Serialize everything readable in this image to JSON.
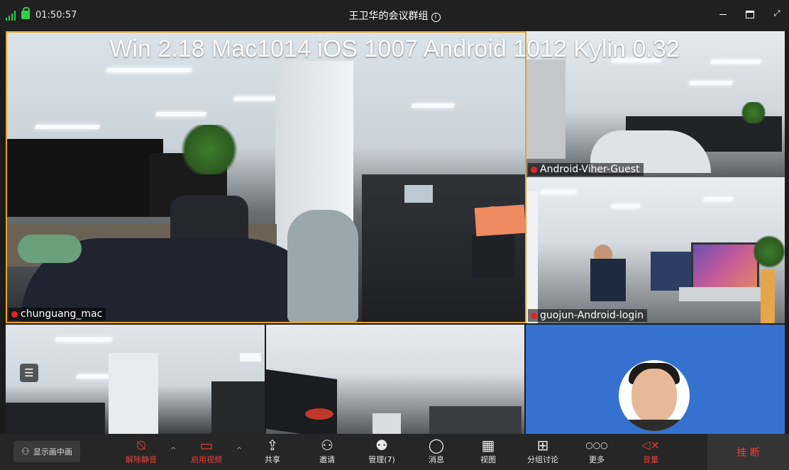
{
  "titlebar": {
    "time": "01:50:57",
    "title": "王卫华的会议群组",
    "info_glyph": "i",
    "minimize_icon": "minimize-icon",
    "maximize_icon": "maximize-icon",
    "exit_fullscreen_icon": "exit-fullscreen-icon"
  },
  "overlay": {
    "text": "Win 2.18 Mac1014 iOS 1007 Android 1012 Kylin 0.32"
  },
  "participants": [
    {
      "name": "chunguang_mac"
    },
    {
      "name": "Android-Viher-Guest"
    },
    {
      "name": "guojun-Android-login"
    }
  ],
  "list_button": {
    "glyph": "☰"
  },
  "toolbar": {
    "gallery_label": "显示画中画",
    "items": [
      {
        "label": "解除静音",
        "icon": "mic-muted-icon",
        "glyph": "⍉"
      },
      {
        "label": "启用视频",
        "icon": "video-off-icon",
        "glyph": "▭"
      },
      {
        "label": "共享",
        "icon": "share-icon",
        "glyph": "⇪"
      },
      {
        "label": "邀请",
        "icon": "invite-icon",
        "glyph": "⚇"
      },
      {
        "label": "管理(7)",
        "icon": "manage-participants-icon",
        "glyph": "⚉"
      },
      {
        "label": "消息",
        "icon": "message-icon",
        "glyph": "◯"
      },
      {
        "label": "视图",
        "icon": "view-icon",
        "glyph": "▦"
      },
      {
        "label": "分组讨论",
        "icon": "breakout-icon",
        "glyph": "⊞"
      },
      {
        "label": "更多",
        "icon": "more-icon",
        "glyph": "○○○"
      },
      {
        "label": "音量",
        "icon": "speaker-muted-icon",
        "glyph": "◁×"
      }
    ],
    "chevron": "^",
    "hangup_label": "挂 断"
  },
  "colors": {
    "accent_red": "#e8413c",
    "active_speaker_border": "#e9a224",
    "signal_green": "#2fd14b",
    "avatar_tile_blue": "#3572d0"
  }
}
